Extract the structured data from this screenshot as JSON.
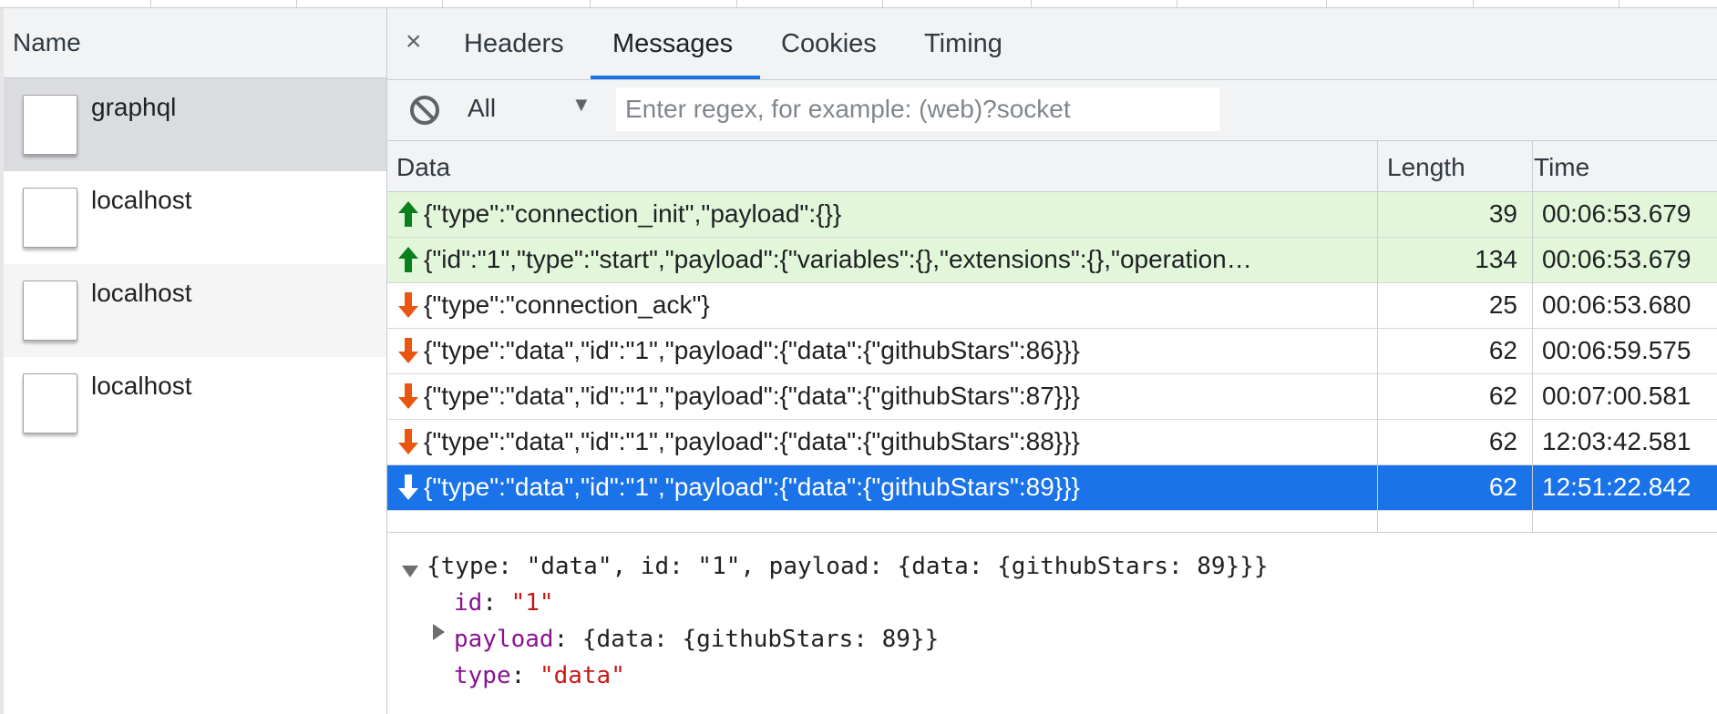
{
  "sidebar": {
    "header": "Name",
    "items": [
      {
        "name": "graphql",
        "selected": true
      },
      {
        "name": "localhost",
        "selected": false
      },
      {
        "name": "localhost",
        "selected": false
      },
      {
        "name": "localhost",
        "selected": false
      }
    ]
  },
  "tabs": {
    "close": "×",
    "items": [
      "Headers",
      "Messages",
      "Cookies",
      "Timing"
    ],
    "active": "Messages"
  },
  "filter": {
    "selected": "All",
    "placeholder": "Enter regex, for example: (web)?socket"
  },
  "grid": {
    "columns": {
      "data": "Data",
      "length": "Length",
      "time": "Time"
    },
    "rows": [
      {
        "direction": "sent",
        "data": "{\"type\":\"connection_init\",\"payload\":{}}",
        "length": "39",
        "time": "00:06:53.679"
      },
      {
        "direction": "sent",
        "data": "{\"id\":\"1\",\"type\":\"start\",\"payload\":{\"variables\":{},\"extensions\":{},\"operation…",
        "length": "134",
        "time": "00:06:53.679"
      },
      {
        "direction": "received",
        "data": "{\"type\":\"connection_ack\"}",
        "length": "25",
        "time": "00:06:53.680"
      },
      {
        "direction": "received",
        "data": "{\"type\":\"data\",\"id\":\"1\",\"payload\":{\"data\":{\"githubStars\":86}}}",
        "length": "62",
        "time": "00:06:59.575"
      },
      {
        "direction": "received",
        "data": "{\"type\":\"data\",\"id\":\"1\",\"payload\":{\"data\":{\"githubStars\":87}}}",
        "length": "62",
        "time": "00:07:00.581"
      },
      {
        "direction": "received",
        "data": "{\"type\":\"data\",\"id\":\"1\",\"payload\":{\"data\":{\"githubStars\":88}}}",
        "length": "62",
        "time": "12:03:42.581"
      },
      {
        "direction": "received",
        "data": "{\"type\":\"data\",\"id\":\"1\",\"payload\":{\"data\":{\"githubStars\":89}}}",
        "length": "62",
        "time": "12:51:22.842",
        "selected": true
      }
    ]
  },
  "detail": {
    "summary": "{type: \"data\", id: \"1\", payload: {data: {githubStars: 89}}}",
    "id_key": "id",
    "id_value": "\"1\"",
    "payload_key": "payload",
    "payload_value": "{data: {githubStars: 89}}",
    "type_key": "type",
    "type_value": "\"data\""
  },
  "colors": {
    "sent_row": "#e2f7da",
    "selected_row": "#1a73e8",
    "sent_arrow": "#0a7f1d",
    "received_arrow": "#e8560f",
    "accent": "#1a73e8"
  }
}
